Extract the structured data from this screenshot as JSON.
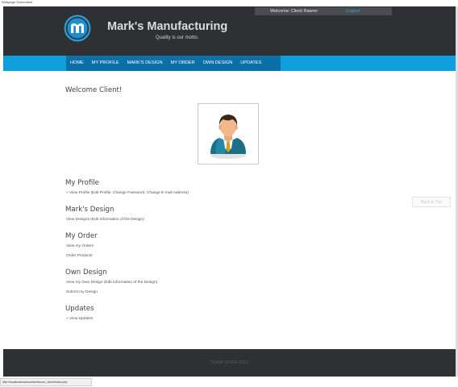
{
  "caption": "Webpage Screenshot",
  "header": {
    "welcome_text": "Welcome: Client Rawrer",
    "logout_label": "Logout",
    "brand_title": "Mark's Manufacturing",
    "brand_motto": "Quality is our motto."
  },
  "nav": {
    "items": [
      {
        "label": "HOME"
      },
      {
        "label": "MY PROFILE"
      },
      {
        "label": "MARK'S DESIGN"
      },
      {
        "label": "MY ORDER"
      },
      {
        "label": "OWN DESIGN"
      },
      {
        "label": "UPDATES"
      }
    ]
  },
  "main": {
    "welcome_heading": "Welcome Client!",
    "sections": [
      {
        "title": "My Profile",
        "links": [
          "» View Profile (Edit Profile, Change Password, Change E-mail Address)"
        ]
      },
      {
        "title": "Mark's Design",
        "links": [
          "View Designs (Edit Information of the Design)"
        ]
      },
      {
        "title": "My Order",
        "links": [
          "View my Orders",
          "Order Products"
        ]
      },
      {
        "title": "Own Design",
        "links": [
          "View my Own Design (Edit Information of the Design)",
          "Submit my Design"
        ]
      },
      {
        "title": "Updates",
        "links": [
          "» View Updates"
        ]
      }
    ],
    "back_to_top": "Back to Top"
  },
  "footer": {
    "text": "TEAM GORA 2012"
  },
  "status_bar": {
    "url": "http://localhost/markonline/secure_client/index.php"
  },
  "colors": {
    "header_bg": "#2e3033",
    "nav_bg": "#0ea0dc",
    "nav_active_bg": "#0b6fa8",
    "logout_link": "#3aa8dc"
  }
}
